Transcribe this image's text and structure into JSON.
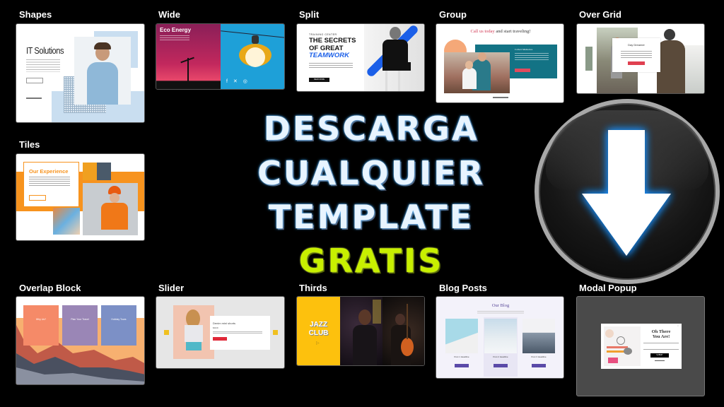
{
  "headline": {
    "line1": "DESCARGA",
    "line2": "CUALQUIER",
    "line3": "TEMPLATE",
    "line4": "GRATIS"
  },
  "download_icon": "download-arrow-icon",
  "colors": {
    "background": "#000000",
    "headline_text": "#e8f4ff",
    "headline_accent": "#c8f000",
    "arrow_glow": "#1e90ff"
  },
  "templates": [
    {
      "label": "Shapes",
      "title": "IT Solutions",
      "button": "Learn more"
    },
    {
      "label": "Wide",
      "title": "Eco Energy",
      "social": [
        "f",
        "t",
        "ig"
      ]
    },
    {
      "label": "Split",
      "kicker": "TRAINING CENTER",
      "title_line1": "THE SECRETS",
      "title_line2": "OF GREAT",
      "title_line3": "TEAMWORK",
      "button": "READ MORE"
    },
    {
      "label": "Group",
      "title_accent": "Call us today",
      "title_rest": " and start traveling!",
      "box_title": "Collect Memories",
      "button": "Learn more"
    },
    {
      "label": "Over Grid",
      "title": "Day Dreamer",
      "button": "Learn more"
    },
    {
      "label": "Tiles",
      "title": "Our Experience",
      "button": "Learn more"
    },
    {
      "label": "Overlap Block",
      "cols": [
        "Why Us?",
        "Plan Your Travel",
        "Holiday Tours"
      ]
    },
    {
      "label": "Slider",
      "title": "Denim mini shorts",
      "price": "$19.00",
      "button": "Add to cart"
    },
    {
      "label": "Thirds",
      "title_line1": "JAZZ",
      "title_line2": "CLUB"
    },
    {
      "label": "Blog Posts",
      "title": "Our Blog",
      "posts": [
        "Post 1 Headline",
        "Post 2 Headline",
        "Post 3 Headline"
      ],
      "button": "Read more"
    },
    {
      "label": "Modal Popup",
      "title_line1": "Oh There",
      "title_line2": "You Are!",
      "button": "SUBMIT"
    }
  ]
}
